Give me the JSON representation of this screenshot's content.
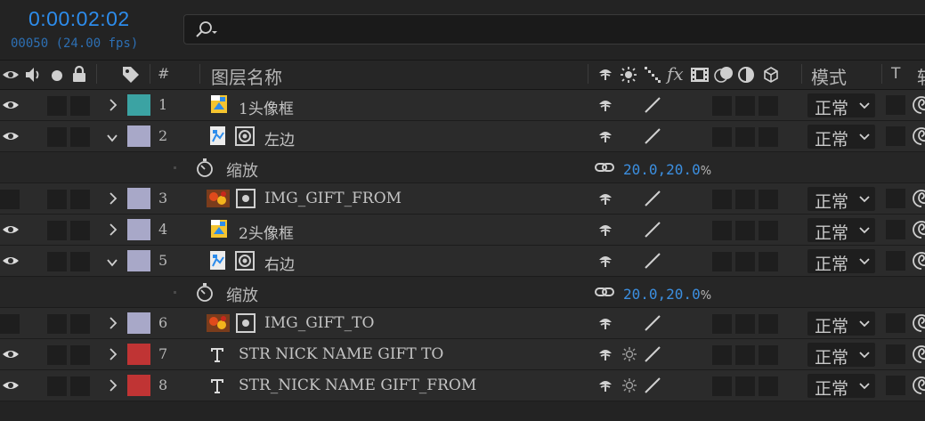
{
  "timecode": "0:00:02:02",
  "frames": "00050 (24.00 fps)",
  "search": {
    "icon": "search-icon"
  },
  "header": {
    "hash": "#",
    "layer_name": "图层名称",
    "fx": "fx",
    "mode": "模式",
    "t": "T",
    "cut": "轨"
  },
  "layers": [
    {
      "num": "1",
      "name": "1头像框",
      "type": "psd",
      "color": "#3ba3a3",
      "visible": true,
      "expanded": false,
      "mode": "正常"
    },
    {
      "num": "2",
      "name": "左边",
      "type": "precomp",
      "color": "#a8a8c8",
      "visible": true,
      "expanded": true,
      "mode": "正常"
    },
    {
      "num": "3",
      "name": "IMG_GIFT_FROM",
      "type": "image",
      "color": "#a8a8c8",
      "visible": false,
      "expanded": false,
      "mode": "正常"
    },
    {
      "num": "4",
      "name": "2头像框",
      "type": "psd",
      "color": "#a8a8c8",
      "visible": true,
      "expanded": false,
      "mode": "正常"
    },
    {
      "num": "5",
      "name": "右边",
      "type": "precomp",
      "color": "#a8a8c8",
      "visible": true,
      "expanded": true,
      "mode": "正常"
    },
    {
      "num": "6",
      "name": "IMG_GIFT_TO",
      "type": "image",
      "color": "#a8a8c8",
      "visible": false,
      "expanded": false,
      "mode": "正常"
    },
    {
      "num": "7",
      "name": "STR NICK NAME GIFT TO",
      "type": "text",
      "color": "#c03434",
      "visible": true,
      "expanded": false,
      "mode": "正常"
    },
    {
      "num": "8",
      "name": "STR_NICK NAME GIFT_FROM",
      "type": "text",
      "color": "#c03434",
      "visible": true,
      "expanded": false,
      "mode": "正常"
    }
  ],
  "props": [
    {
      "name": "缩放",
      "value": "20.0,20.0",
      "unit": "%"
    },
    {
      "name": "缩放",
      "value": "20.0,20.0",
      "unit": "%"
    }
  ]
}
